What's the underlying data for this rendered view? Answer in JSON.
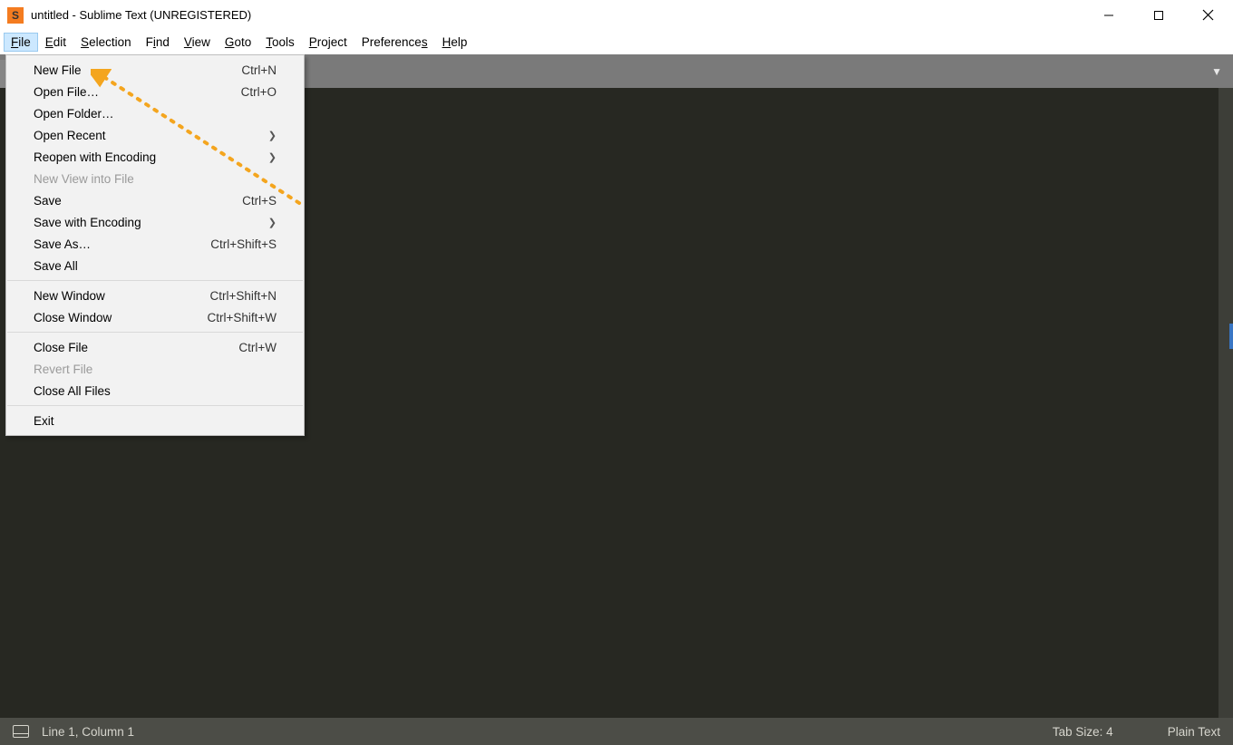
{
  "title": "untitled - Sublime Text (UNREGISTERED)",
  "menubar": [
    "File",
    "Edit",
    "Selection",
    "Find",
    "View",
    "Goto",
    "Tools",
    "Project",
    "Preferences",
    "Help"
  ],
  "file_menu": {
    "groups": [
      [
        {
          "label": "New File",
          "shortcut": "Ctrl+N",
          "sub": false,
          "disabled": false
        },
        {
          "label": "Open File…",
          "shortcut": "Ctrl+O",
          "sub": false,
          "disabled": false
        },
        {
          "label": "Open Folder…",
          "shortcut": "",
          "sub": false,
          "disabled": false
        },
        {
          "label": "Open Recent",
          "shortcut": "",
          "sub": true,
          "disabled": false
        },
        {
          "label": "Reopen with Encoding",
          "shortcut": "",
          "sub": true,
          "disabled": false
        },
        {
          "label": "New View into File",
          "shortcut": "",
          "sub": false,
          "disabled": true
        },
        {
          "label": "Save",
          "shortcut": "Ctrl+S",
          "sub": false,
          "disabled": false
        },
        {
          "label": "Save with Encoding",
          "shortcut": "",
          "sub": true,
          "disabled": false
        },
        {
          "label": "Save As…",
          "shortcut": "Ctrl+Shift+S",
          "sub": false,
          "disabled": false
        },
        {
          "label": "Save All",
          "shortcut": "",
          "sub": false,
          "disabled": false
        }
      ],
      [
        {
          "label": "New Window",
          "shortcut": "Ctrl+Shift+N",
          "sub": false,
          "disabled": false
        },
        {
          "label": "Close Window",
          "shortcut": "Ctrl+Shift+W",
          "sub": false,
          "disabled": false
        }
      ],
      [
        {
          "label": "Close File",
          "shortcut": "Ctrl+W",
          "sub": false,
          "disabled": false
        },
        {
          "label": "Revert File",
          "shortcut": "",
          "sub": false,
          "disabled": true
        },
        {
          "label": "Close All Files",
          "shortcut": "",
          "sub": false,
          "disabled": false
        }
      ],
      [
        {
          "label": "Exit",
          "shortcut": "",
          "sub": false,
          "disabled": false
        }
      ]
    ]
  },
  "status": {
    "cursor": "Line 1, Column 1",
    "tabsize": "Tab Size: 4",
    "syntax": "Plain Text"
  }
}
